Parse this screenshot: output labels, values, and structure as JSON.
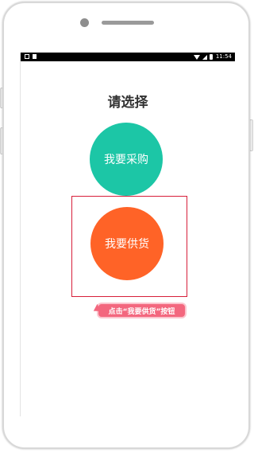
{
  "status_bar": {
    "time": "11:54",
    "icons": [
      "image-icon",
      "notification-icon",
      "wifi-icon",
      "signal-icon",
      "battery-icon"
    ]
  },
  "page": {
    "title": "请选择"
  },
  "options": {
    "buy_label": "我要采购",
    "supply_label": "我要供货"
  },
  "guide": {
    "tooltip_text": "点击“我要供货”按钮"
  },
  "colors": {
    "buy": "#1cc6a6",
    "supply": "#ff6327",
    "highlight": "#d71f3a",
    "tooltip": "#f3677e"
  }
}
